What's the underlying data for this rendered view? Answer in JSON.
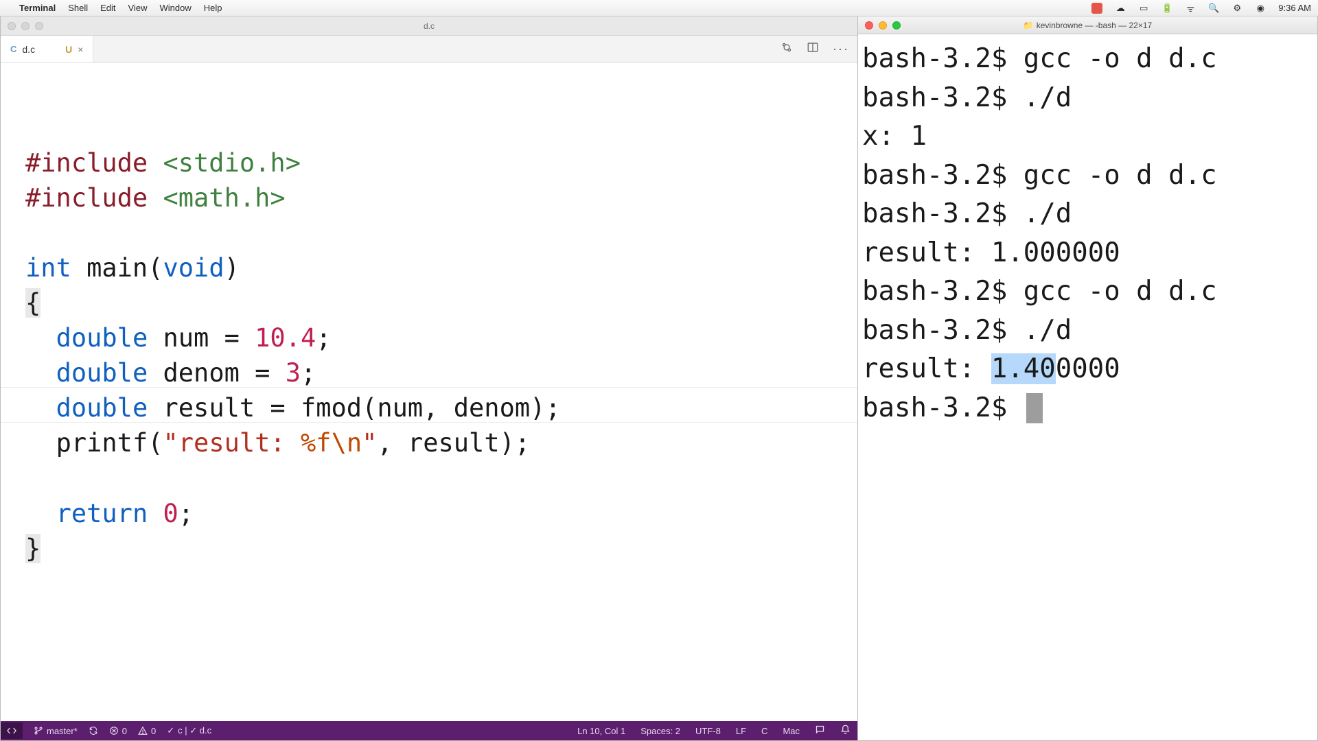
{
  "menubar": {
    "apple": "",
    "app": "Terminal",
    "items": [
      "Shell",
      "Edit",
      "View",
      "Window",
      "Help"
    ],
    "clock": "9:36 AM"
  },
  "editor": {
    "window_title": "d.c",
    "tab": {
      "lang": "C",
      "filename": "d.c",
      "modified": "U",
      "close": "×"
    },
    "code_tokens": {
      "l1_prep": "#include ",
      "l1_inc": "<stdio.h>",
      "l2_prep": "#include ",
      "l2_inc": "<math.h>",
      "l4_kw": "int ",
      "l4_fn": "main(",
      "l4_void": "void",
      "l4_close": ")",
      "l5": "{",
      "l6_ind": "  ",
      "l6_type": "double ",
      "l6_id": "num = ",
      "l6_num": "10.4",
      "l6_semi": ";",
      "l7_ind": "  ",
      "l7_type": "double ",
      "l7_id": "denom = ",
      "l7_num": "3",
      "l7_semi": ";",
      "l8_ind": "  ",
      "l8_type": "double ",
      "l8_id": "result = fmod(num, denom);",
      "l9_ind": "  ",
      "l9_fn": "printf(",
      "l9_q1": "\"",
      "l9_str": "result: ",
      "l9_fmt": "%f",
      "l9_esc": "\\n",
      "l9_q2": "\"",
      "l9_rest": ", result);",
      "l11_ind": "  ",
      "l11_kw": "return ",
      "l11_num": "0",
      "l11_semi": ";",
      "l12": "}"
    },
    "statusbar": {
      "branch": "master*",
      "errors": "0",
      "warnings": "0",
      "lint": "c | ✓ d.c",
      "lncol": "Ln 10, Col 1",
      "spaces": "Spaces: 2",
      "encoding": "UTF-8",
      "eol": "LF",
      "lang": "C",
      "os": "Mac"
    }
  },
  "terminal": {
    "title_folder": "kevinbrowne",
    "title_rest": " — -bash — 22×17",
    "lines": [
      "bash-3.2$ gcc -o d d.c",
      "bash-3.2$ ./d",
      "x: 1",
      "bash-3.2$ gcc -o d d.c",
      "bash-3.2$ ./d",
      "result: 1.000000",
      "bash-3.2$ gcc -o d d.c",
      "bash-3.2$ ./d"
    ],
    "line_result_prefix": "result: ",
    "line_result_sel": "1.40",
    "line_result_suffix": "0000",
    "prompt": "bash-3.2$ "
  }
}
